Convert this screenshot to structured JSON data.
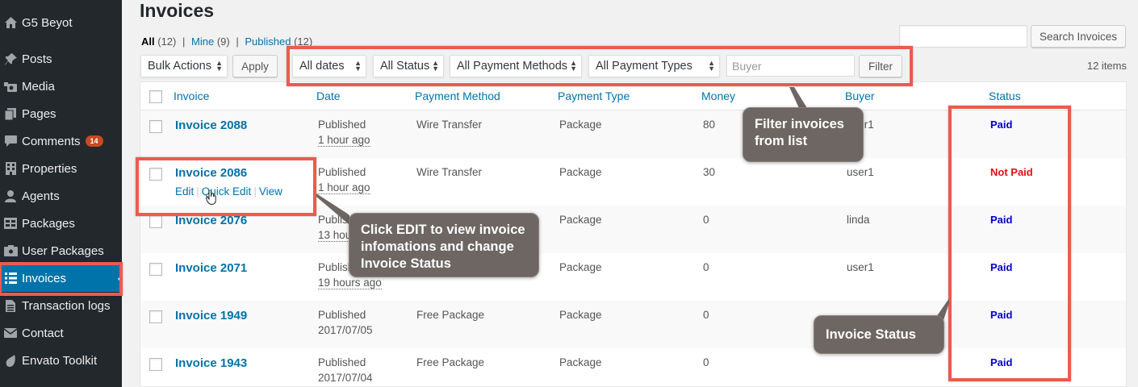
{
  "sidebar": {
    "site_name": "G5 Beyot",
    "items": [
      {
        "label": "Posts",
        "icon": "pin-icon"
      },
      {
        "label": "Media",
        "icon": "media-icon"
      },
      {
        "label": "Pages",
        "icon": "pages-icon"
      },
      {
        "label": "Comments",
        "icon": "comments-icon",
        "badge": "14"
      },
      {
        "label": "Properties",
        "icon": "building-icon"
      },
      {
        "label": "Agents",
        "icon": "user-icon"
      },
      {
        "label": "Packages",
        "icon": "grid-icon"
      },
      {
        "label": "User Packages",
        "icon": "package-icon"
      },
      {
        "label": "Invoices",
        "icon": "list-icon",
        "active": true
      },
      {
        "label": "Transaction logs",
        "icon": "document-icon"
      },
      {
        "label": "Contact",
        "icon": "email-icon"
      },
      {
        "label": "Envato Toolkit",
        "icon": "leaf-icon"
      }
    ]
  },
  "page": {
    "title": "Invoices",
    "views": {
      "all": "All",
      "all_count": "(12)",
      "mine": "Mine",
      "mine_count": "(9)",
      "published": "Published",
      "published_count": "(12)"
    },
    "search_button": "Search Invoices",
    "items_count": "12 items"
  },
  "toolbar": {
    "bulk_actions": "Bulk Actions",
    "apply": "Apply",
    "dates": "All dates",
    "status": "All Status",
    "payment_methods": "All Payment Methods",
    "payment_types": "All Payment Types",
    "buyer_placeholder": "Buyer",
    "filter": "Filter"
  },
  "table": {
    "columns": {
      "invoice": "Invoice",
      "date": "Date",
      "payment_method": "Payment Method",
      "payment_type": "Payment Type",
      "money": "Money",
      "buyer": "Buyer",
      "status": "Status"
    },
    "row_actions": {
      "edit": "Edit",
      "quick_edit": "Quick Edit",
      "view": "View"
    },
    "rows": [
      {
        "title": "Invoice 2088",
        "date_status": "Published",
        "date_ago": "1 hour ago",
        "method": "Wire Transfer",
        "type": "Package",
        "money": "80",
        "buyer": "user1",
        "status": "Paid"
      },
      {
        "title": "Invoice 2086",
        "date_status": "Published",
        "date_ago": "1 hour ago",
        "method": "Wire Transfer",
        "type": "Package",
        "money": "30",
        "buyer": "user1",
        "status": "Not Paid"
      },
      {
        "title": "Invoice 2076",
        "date_status": "Published",
        "date_ago": "13 hours ago",
        "method": "",
        "type": "Package",
        "money": "0",
        "buyer": "linda",
        "status": "Paid"
      },
      {
        "title": "Invoice 2071",
        "date_status": "Published",
        "date_ago": "19 hours ago",
        "method": "",
        "type": "Package",
        "money": "0",
        "buyer": "user1",
        "status": "Paid"
      },
      {
        "title": "Invoice 1949",
        "date_status": "Published",
        "date_ago": "2017/07/05",
        "method": "Free Package",
        "type": "Package",
        "money": "0",
        "buyer": "",
        "status": "Paid"
      },
      {
        "title": "Invoice 1943",
        "date_status": "Published",
        "date_ago": "2017/07/04",
        "method": "Free Package",
        "type": "Package",
        "money": "0",
        "buyer": "",
        "status": "Paid"
      }
    ]
  },
  "annotations": {
    "filter": "Filter invoices from list",
    "edit": "Click EDIT to view invoice infomations and change Invoice Status",
    "status": "Invoice Status"
  },
  "colors": {
    "accent": "#0073aa",
    "highlight": "#ee5a4e",
    "paid": "#0000cc",
    "not_paid": "#dd1111",
    "callout": "#6d6663"
  }
}
